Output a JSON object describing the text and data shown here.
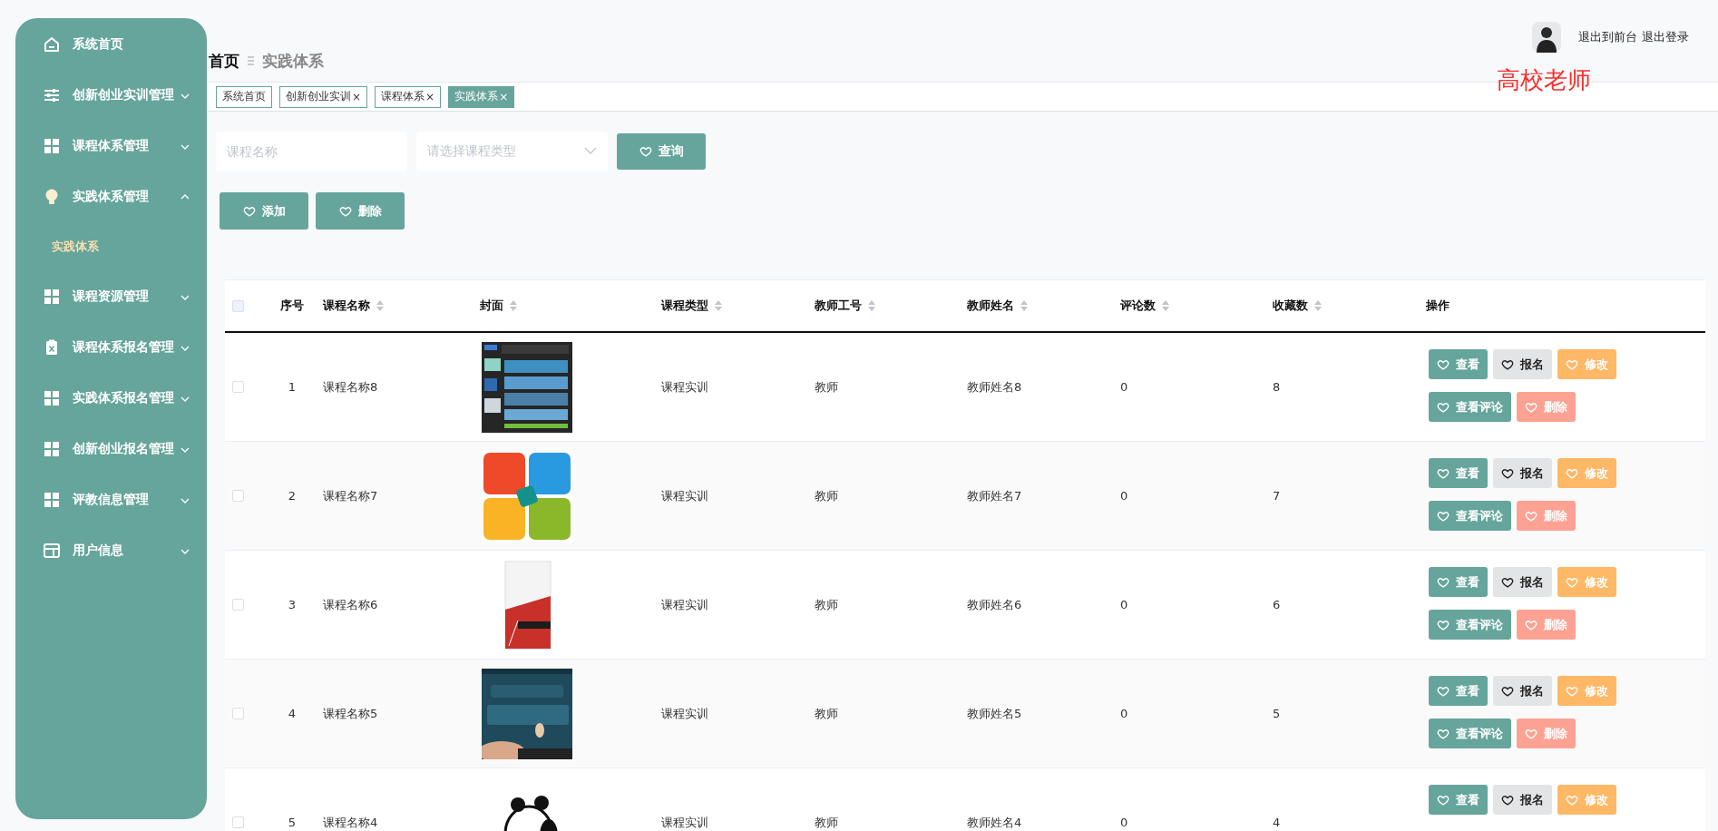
{
  "sidebar": {
    "items": [
      {
        "label": "系统首页"
      },
      {
        "label": "创新创业实训管理",
        "expanded": false
      },
      {
        "label": "课程体系管理",
        "expanded": false
      },
      {
        "label": "实践体系管理",
        "expanded": true,
        "children": [
          {
            "label": "实践体系",
            "selected": true
          }
        ]
      },
      {
        "label": "课程资源管理",
        "expanded": false
      },
      {
        "label": "课程体系报名管理",
        "expanded": false
      },
      {
        "label": "实践体系报名管理",
        "expanded": false
      },
      {
        "label": "创新创业报名管理",
        "expanded": false
      },
      {
        "label": "评教信息管理",
        "expanded": false
      },
      {
        "label": "用户信息",
        "expanded": false
      }
    ]
  },
  "header": {
    "breadcrumb": [
      "首页",
      "实践体系"
    ],
    "user_actions": [
      "退出到前台",
      "退出登录"
    ],
    "role": "高校老师"
  },
  "tags": [
    {
      "label": "系统首页",
      "selected": false
    },
    {
      "label": "创新创业实训",
      "close": "×",
      "selected": false
    },
    {
      "label": "课程体系",
      "close": "×",
      "selected": false
    },
    {
      "label": "实践体系",
      "close": "×",
      "selected": true
    }
  ],
  "search": {
    "fields": [
      {
        "kind": "text",
        "placeholder": "课程名称"
      },
      {
        "kind": "select",
        "placeholder": "请选择课程类型"
      }
    ],
    "button": "查询"
  },
  "toolbar": [
    "添加",
    "删除"
  ],
  "table": {
    "select_all": {
      "checked": false
    },
    "columns": [
      {
        "label": "序号",
        "kind": "text",
        "sortable": false
      },
      {
        "label": "课程名称",
        "kind": "text",
        "sortable": true
      },
      {
        "label": "封面",
        "kind": "picture",
        "sortable": true
      },
      {
        "label": "课程类型",
        "kind": "text",
        "sortable": true
      },
      {
        "label": "教师工号",
        "kind": "text",
        "sortable": true
      },
      {
        "label": "教师姓名",
        "kind": "text",
        "sortable": true
      },
      {
        "label": "评论数",
        "kind": "text",
        "sortable": true
      },
      {
        "label": "收藏数",
        "kind": "text",
        "sortable": true
      },
      {
        "label": "操作",
        "kind": "actions",
        "sortable": false
      }
    ],
    "rows": [
      {
        "checked": false,
        "cells": [
          "1",
          "课程名称8",
          {
            "kind": "picture"
          },
          "课程实训",
          "教师",
          "教师姓名8",
          "0",
          "8"
        ],
        "actions": [
          {
            "label": "查看",
            "kind": "view"
          },
          {
            "label": "报名",
            "kind": "enroll"
          },
          {
            "label": "修改",
            "kind": "edit"
          },
          {
            "label": "查看评论",
            "kind": "view"
          },
          {
            "label": "删除",
            "kind": "delete"
          }
        ]
      },
      {
        "checked": false,
        "cells": [
          "2",
          "课程名称7",
          {
            "kind": "picture"
          },
          "课程实训",
          "教师",
          "教师姓名7",
          "0",
          "7"
        ],
        "actions": [
          {
            "label": "查看",
            "kind": "view"
          },
          {
            "label": "报名",
            "kind": "enroll"
          },
          {
            "label": "修改",
            "kind": "edit"
          },
          {
            "label": "查看评论",
            "kind": "view"
          },
          {
            "label": "删除",
            "kind": "delete"
          }
        ]
      },
      {
        "checked": false,
        "cells": [
          "3",
          "课程名称6",
          {
            "kind": "picture"
          },
          "课程实训",
          "教师",
          "教师姓名6",
          "0",
          "6"
        ],
        "actions": [
          {
            "label": "查看",
            "kind": "view"
          },
          {
            "label": "报名",
            "kind": "enroll"
          },
          {
            "label": "修改",
            "kind": "edit"
          },
          {
            "label": "查看评论",
            "kind": "view"
          },
          {
            "label": "删除",
            "kind": "delete"
          }
        ]
      },
      {
        "checked": false,
        "cells": [
          "4",
          "课程名称5",
          {
            "kind": "picture"
          },
          "课程实训",
          "教师",
          "教师姓名5",
          "0",
          "5"
        ],
        "actions": [
          {
            "label": "查看",
            "kind": "view"
          },
          {
            "label": "报名",
            "kind": "enroll"
          },
          {
            "label": "修改",
            "kind": "edit"
          },
          {
            "label": "查看评论",
            "kind": "view"
          },
          {
            "label": "删除",
            "kind": "delete"
          }
        ]
      },
      {
        "checked": false,
        "cells": [
          "5",
          "课程名称4",
          {
            "kind": "picture"
          },
          "课程实训",
          "教师",
          "教师姓名4",
          "0",
          "4"
        ],
        "actions": [
          {
            "label": "查看",
            "kind": "view"
          },
          {
            "label": "报名",
            "kind": "enroll"
          },
          {
            "label": "修改",
            "kind": "edit"
          }
        ]
      }
    ]
  }
}
